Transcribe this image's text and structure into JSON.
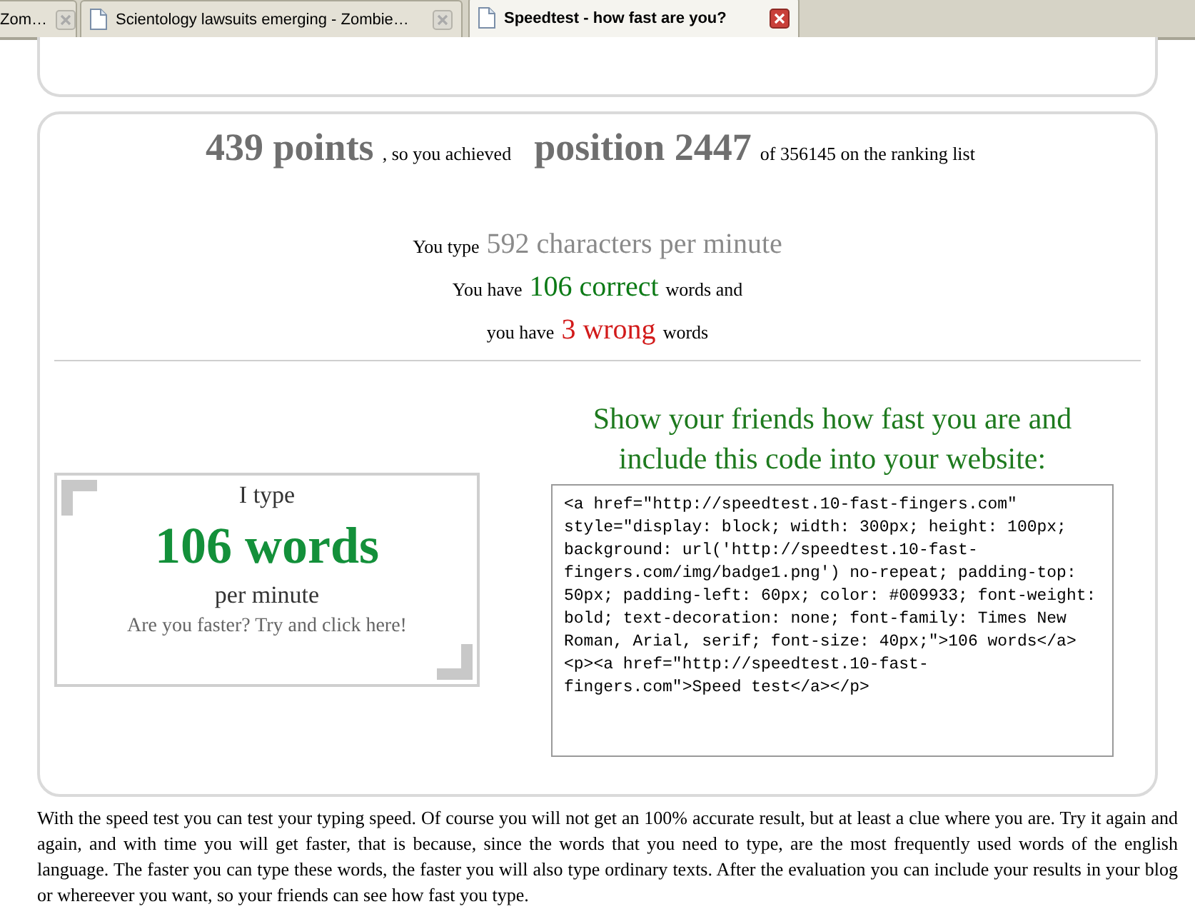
{
  "tabs": [
    {
      "label": "Zom…",
      "selected": false
    },
    {
      "label": "Scientology lawsuits emerging - Zombie…",
      "selected": false
    },
    {
      "label": "Speedtest - how fast are you?",
      "selected": true
    }
  ],
  "result": {
    "points": "439 points",
    "achieved": ", so you achieved",
    "position": "position 2447",
    "of_total": "of 356145 on the ranking list"
  },
  "stats": [
    {
      "kind": "speed",
      "before": "You type",
      "value": "592 characters per minute"
    },
    {
      "kind": "correct",
      "before": "You have",
      "value": "106 correct",
      "after": "words and"
    },
    {
      "kind": "wrong",
      "before": "you have",
      "value": "3 wrong",
      "after": "words"
    }
  ],
  "badge": {
    "line_1": "I type",
    "words": "106 words",
    "line_3": "per minute",
    "link": "Are you faster? Try and click here!"
  },
  "share": {
    "heading": "Show your friends how fast you are and include this code into your website:",
    "code": "<a href=\"http://speedtest.10-fast-fingers.com\" style=\"display: block; width: 300px; height: 100px; background: url('http://speedtest.10-fast-fingers.com/img/badge1.png') no-repeat; padding-top: 50px; padding-left: 60px; color: #009933; font-weight: bold; text-decoration: none; font-family: Times New Roman, Arial, serif; font-size: 40px;\">106 words</a><p><a href=\"http://speedtest.10-fast-fingers.com\">Speed test</a></p>"
  },
  "description": "With the speed test you can test your typing speed. Of course you will not get an 100% accurate result, but at least a clue where you are. Try it again and again, and with time you will get faster, that is because, since the words that you need to type, are the most frequently used words of the english language. The faster you can type these words, the faster you will also type ordinary texts. After the evaluation you can include your results in your blog or whereever you want, so your friends can see how fast you type."
}
